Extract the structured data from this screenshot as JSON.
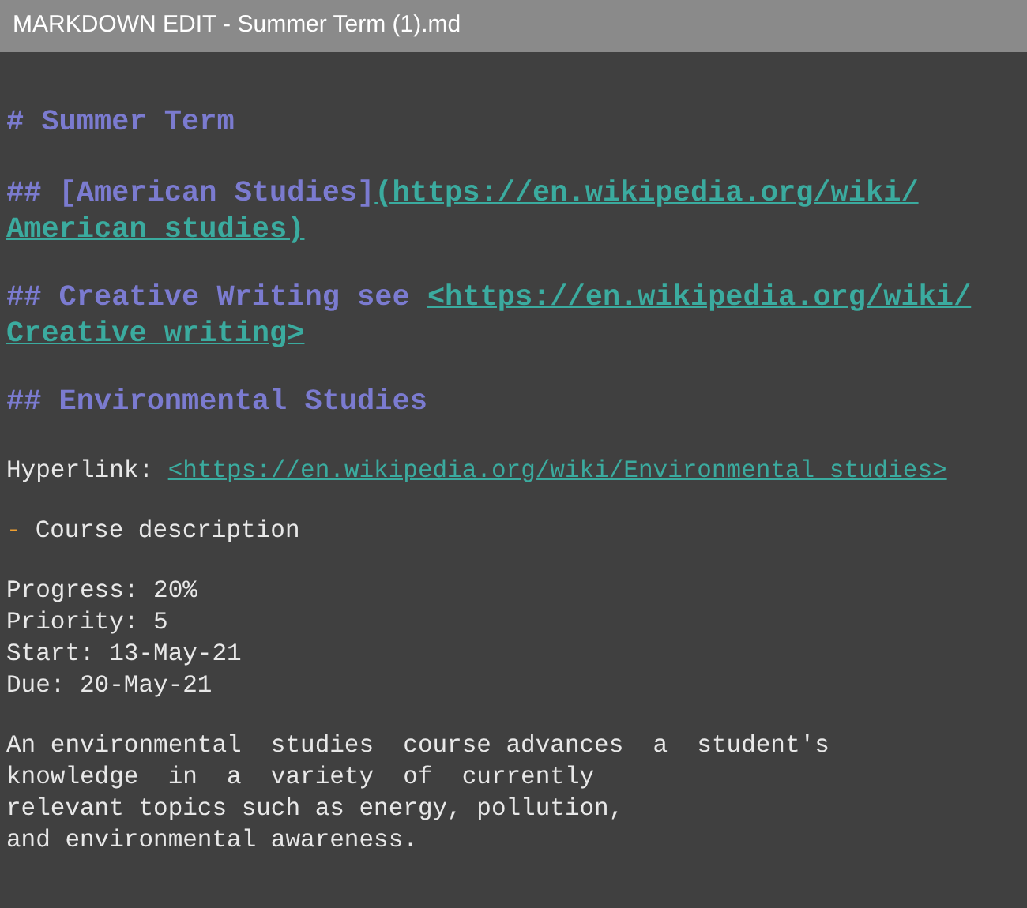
{
  "window": {
    "title": "MARKDOWN EDIT - Summer Term (1).md"
  },
  "blocks": [
    {
      "kind": "heading",
      "text": "# Summer Term"
    },
    {
      "kind": "heading_link",
      "text": "## [American Studies]",
      "link_lines": [
        "(https://en.wikipedia.org/wiki/",
        "American_studies)"
      ]
    },
    {
      "kind": "heading_link",
      "text": "## Creative Writing see ",
      "link_lines": [
        "<https://en.wikipedia.org/wiki/",
        "Creative_writing>"
      ]
    },
    {
      "kind": "heading",
      "text": "## Environmental Studies"
    },
    {
      "kind": "hyperlink",
      "text": "Hyperlink: ",
      "link": "<https://en.wikipedia.org/wiki/Environmental_studies>"
    },
    {
      "kind": "bullet",
      "marker": "-",
      "text": "Course description"
    },
    {
      "kind": "lines",
      "lines": [
        "Progress: 20%",
        "Priority: 5",
        "Start: 13-May-21",
        "Due: 20-May-21"
      ]
    },
    {
      "kind": "paragraph",
      "text": "An environmental  studies  course advances  a  student's\nknowledge  in  a  variety  of  currently\nrelevant topics such as energy, pollution,\nand environmental awareness."
    }
  ]
}
